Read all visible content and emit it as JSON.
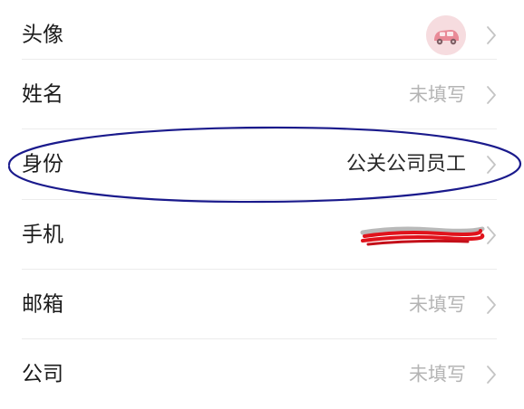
{
  "profile": {
    "rows": [
      {
        "key": "avatar",
        "label": "头像",
        "value": "",
        "placeholder": false
      },
      {
        "key": "name",
        "label": "姓名",
        "value": "未填写",
        "placeholder": true
      },
      {
        "key": "identity",
        "label": "身份",
        "value": "公关公司员工",
        "placeholder": false
      },
      {
        "key": "phone",
        "label": "手机",
        "value": "",
        "placeholder": false
      },
      {
        "key": "email",
        "label": "邮箱",
        "value": "未填写",
        "placeholder": true
      },
      {
        "key": "company",
        "label": "公司",
        "value": "未填写",
        "placeholder": true
      }
    ]
  },
  "icons": {
    "row_arrow": "chevron-right-icon",
    "avatar_image": "pink-car-icon"
  },
  "colors": {
    "placeholder_text": "#b4b4b4",
    "label_text": "#1b1b1b",
    "annotation_ellipse": "#1a1a8c",
    "redaction_mark": "#e0131c"
  }
}
